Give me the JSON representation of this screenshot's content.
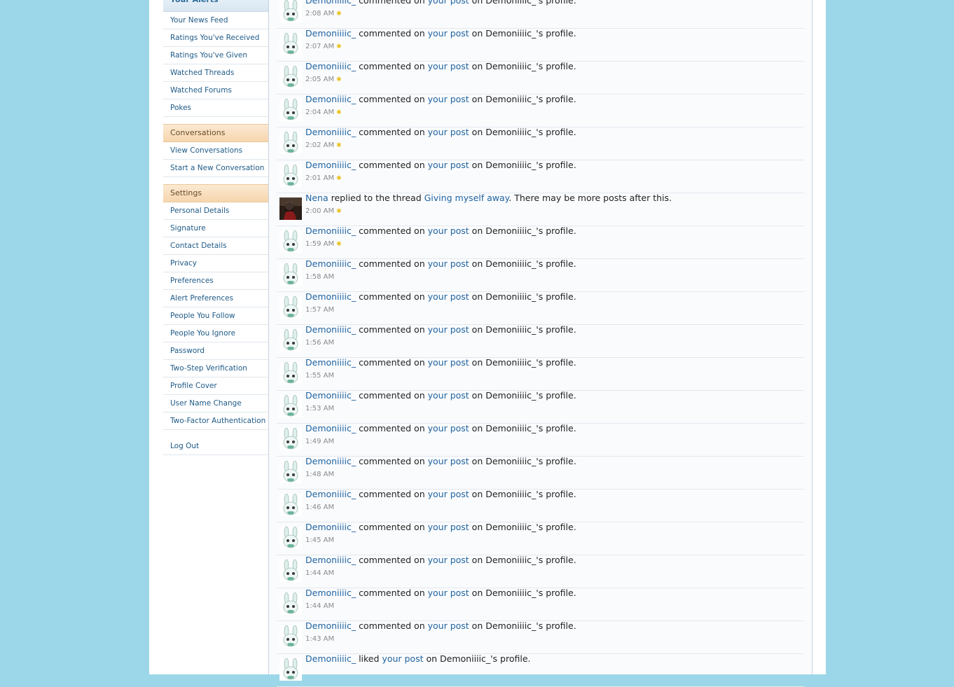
{
  "sidebar": {
    "alerts_title": "Your Alerts",
    "alerts_items": [
      "Your News Feed",
      "Ratings You've Received",
      "Ratings You've Given",
      "Watched Threads",
      "Watched Forums",
      "Pokes"
    ],
    "conversations_title": "Conversations",
    "conversations_items": [
      "View Conversations",
      "Start a New Conversation"
    ],
    "settings_title": "Settings",
    "settings_items": [
      "Personal Details",
      "Signature",
      "Contact Details",
      "Privacy",
      "Preferences",
      "Alert Preferences",
      "People You Follow",
      "People You Ignore",
      "Password",
      "Two-Step Verification",
      "Profile Cover",
      "User Name Change",
      "Two-Factor Authentication"
    ],
    "logout": "Log Out"
  },
  "alerts": [
    {
      "user": "Demoniiiic_",
      "action": "commented on",
      "link": "your post",
      "rest": "on Demoniiiic_'s profile.",
      "time": "2:08 AM",
      "new": true,
      "avatar": "bunny"
    },
    {
      "user": "Demoniiiic_",
      "action": "commented on",
      "link": "your post",
      "rest": "on Demoniiiic_'s profile.",
      "time": "2:07 AM",
      "new": true,
      "avatar": "bunny"
    },
    {
      "user": "Demoniiiic_",
      "action": "commented on",
      "link": "your post",
      "rest": "on Demoniiiic_'s profile.",
      "time": "2:05 AM",
      "new": true,
      "avatar": "bunny"
    },
    {
      "user": "Demoniiiic_",
      "action": "commented on",
      "link": "your post",
      "rest": "on Demoniiiic_'s profile.",
      "time": "2:04 AM",
      "new": true,
      "avatar": "bunny"
    },
    {
      "user": "Demoniiiic_",
      "action": "commented on",
      "link": "your post",
      "rest": "on Demoniiiic_'s profile.",
      "time": "2:02 AM",
      "new": true,
      "avatar": "bunny"
    },
    {
      "user": "Demoniiiic_",
      "action": "commented on",
      "link": "your post",
      "rest": "on Demoniiiic_'s profile.",
      "time": "2:01 AM",
      "new": true,
      "avatar": "bunny"
    },
    {
      "user": "Nena",
      "action": "replied to the thread",
      "link": "Giving myself away",
      "rest": ". There may be more posts after this.",
      "time": "2:00 AM",
      "new": true,
      "avatar": "photo"
    },
    {
      "user": "Demoniiiic_",
      "action": "commented on",
      "link": "your post",
      "rest": "on Demoniiiic_'s profile.",
      "time": "1:59 AM",
      "new": true,
      "avatar": "bunny"
    },
    {
      "user": "Demoniiiic_",
      "action": "commented on",
      "link": "your post",
      "rest": "on Demoniiiic_'s profile.",
      "time": "1:58 AM",
      "new": false,
      "avatar": "bunny"
    },
    {
      "user": "Demoniiiic_",
      "action": "commented on",
      "link": "your post",
      "rest": "on Demoniiiic_'s profile.",
      "time": "1:57 AM",
      "new": false,
      "avatar": "bunny"
    },
    {
      "user": "Demoniiiic_",
      "action": "commented on",
      "link": "your post",
      "rest": "on Demoniiiic_'s profile.",
      "time": "1:56 AM",
      "new": false,
      "avatar": "bunny"
    },
    {
      "user": "Demoniiiic_",
      "action": "commented on",
      "link": "your post",
      "rest": "on Demoniiiic_'s profile.",
      "time": "1:55 AM",
      "new": false,
      "avatar": "bunny"
    },
    {
      "user": "Demoniiiic_",
      "action": "commented on",
      "link": "your post",
      "rest": "on Demoniiiic_'s profile.",
      "time": "1:53 AM",
      "new": false,
      "avatar": "bunny"
    },
    {
      "user": "Demoniiiic_",
      "action": "commented on",
      "link": "your post",
      "rest": "on Demoniiiic_'s profile.",
      "time": "1:49 AM",
      "new": false,
      "avatar": "bunny"
    },
    {
      "user": "Demoniiiic_",
      "action": "commented on",
      "link": "your post",
      "rest": "on Demoniiiic_'s profile.",
      "time": "1:48 AM",
      "new": false,
      "avatar": "bunny"
    },
    {
      "user": "Demoniiiic_",
      "action": "commented on",
      "link": "your post",
      "rest": "on Demoniiiic_'s profile.",
      "time": "1:46 AM",
      "new": false,
      "avatar": "bunny"
    },
    {
      "user": "Demoniiiic_",
      "action": "commented on",
      "link": "your post",
      "rest": "on Demoniiiic_'s profile.",
      "time": "1:45 AM",
      "new": false,
      "avatar": "bunny"
    },
    {
      "user": "Demoniiiic_",
      "action": "commented on",
      "link": "your post",
      "rest": "on Demoniiiic_'s profile.",
      "time": "1:44 AM",
      "new": false,
      "avatar": "bunny"
    },
    {
      "user": "Demoniiiic_",
      "action": "commented on",
      "link": "your post",
      "rest": "on Demoniiiic_'s profile.",
      "time": "1:44 AM",
      "new": false,
      "avatar": "bunny"
    },
    {
      "user": "Demoniiiic_",
      "action": "commented on",
      "link": "your post",
      "rest": "on Demoniiiic_'s profile.",
      "time": "1:43 AM",
      "new": false,
      "avatar": "bunny"
    },
    {
      "user": "Demoniiiic_",
      "action": "liked",
      "link": "your post",
      "rest": "on Demoniiiic_'s profile.",
      "time": "",
      "new": false,
      "avatar": "bunny"
    }
  ],
  "colors": {
    "background": "#9bd7e8",
    "link": "#1f63a0",
    "new_star": "#e8c21d",
    "section_header": "#f6d6ad"
  }
}
